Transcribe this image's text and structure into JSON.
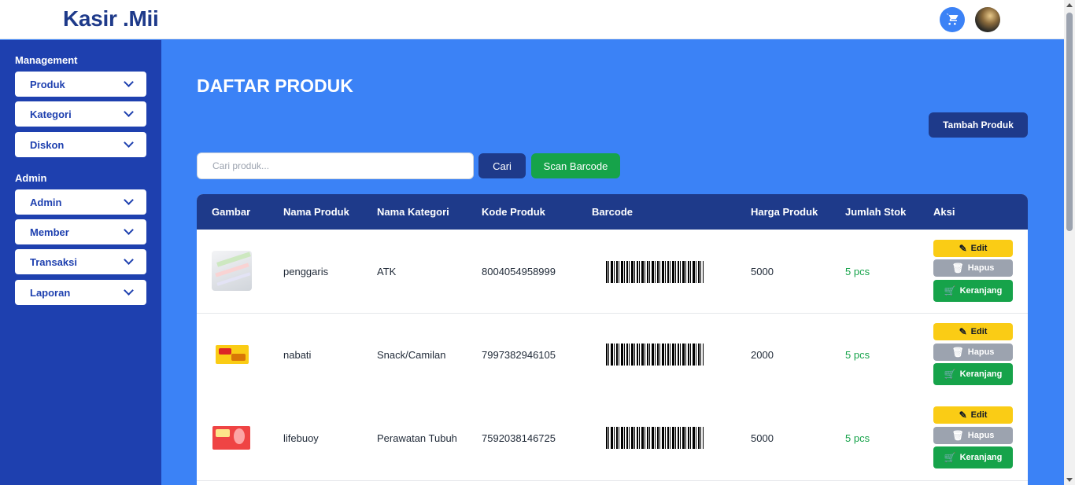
{
  "app": {
    "logo": "Kasir .Mii"
  },
  "header": {
    "cart_icon": "cart-icon",
    "avatar": "user-avatar"
  },
  "sidebar": {
    "sections": [
      {
        "heading": "Management",
        "items": [
          {
            "label": "Produk"
          },
          {
            "label": "Kategori"
          },
          {
            "label": "Diskon"
          }
        ]
      },
      {
        "heading": "Admin",
        "items": [
          {
            "label": "Admin"
          },
          {
            "label": "Member"
          },
          {
            "label": "Transaksi"
          },
          {
            "label": "Laporan"
          }
        ]
      }
    ]
  },
  "page": {
    "title": "DAFTAR PRODUK",
    "add_button": "Tambah Produk"
  },
  "search": {
    "placeholder": "Cari produk...",
    "value": "",
    "search_button": "Cari",
    "scan_button": "Scan Barcode"
  },
  "table": {
    "headers": [
      "Gambar",
      "Nama Produk",
      "Nama Kategori",
      "Kode Produk",
      "Barcode",
      "Harga Produk",
      "Jumlah Stok",
      "Aksi"
    ],
    "actions": {
      "edit": "Edit",
      "hapus": "Hapus",
      "keranjang": "Keranjang"
    },
    "rows": [
      {
        "nama": "penggaris",
        "kategori": "ATK",
        "kode": "8004054958999",
        "harga": "5000",
        "stok": "5 pcs"
      },
      {
        "nama": "nabati",
        "kategori": "Snack/Camilan",
        "kode": "7997382946105",
        "harga": "2000",
        "stok": "5 pcs"
      },
      {
        "nama": "lifebuoy",
        "kategori": "Perawatan Tubuh",
        "kode": "7592038146725",
        "harga": "5000",
        "stok": "5 pcs"
      }
    ]
  },
  "colors": {
    "primary": "#3b82f6",
    "navy": "#1e3a8a",
    "sidebar": "#1e40af",
    "success": "#16a34a",
    "warning": "#facc15",
    "muted": "#9ca3af"
  }
}
